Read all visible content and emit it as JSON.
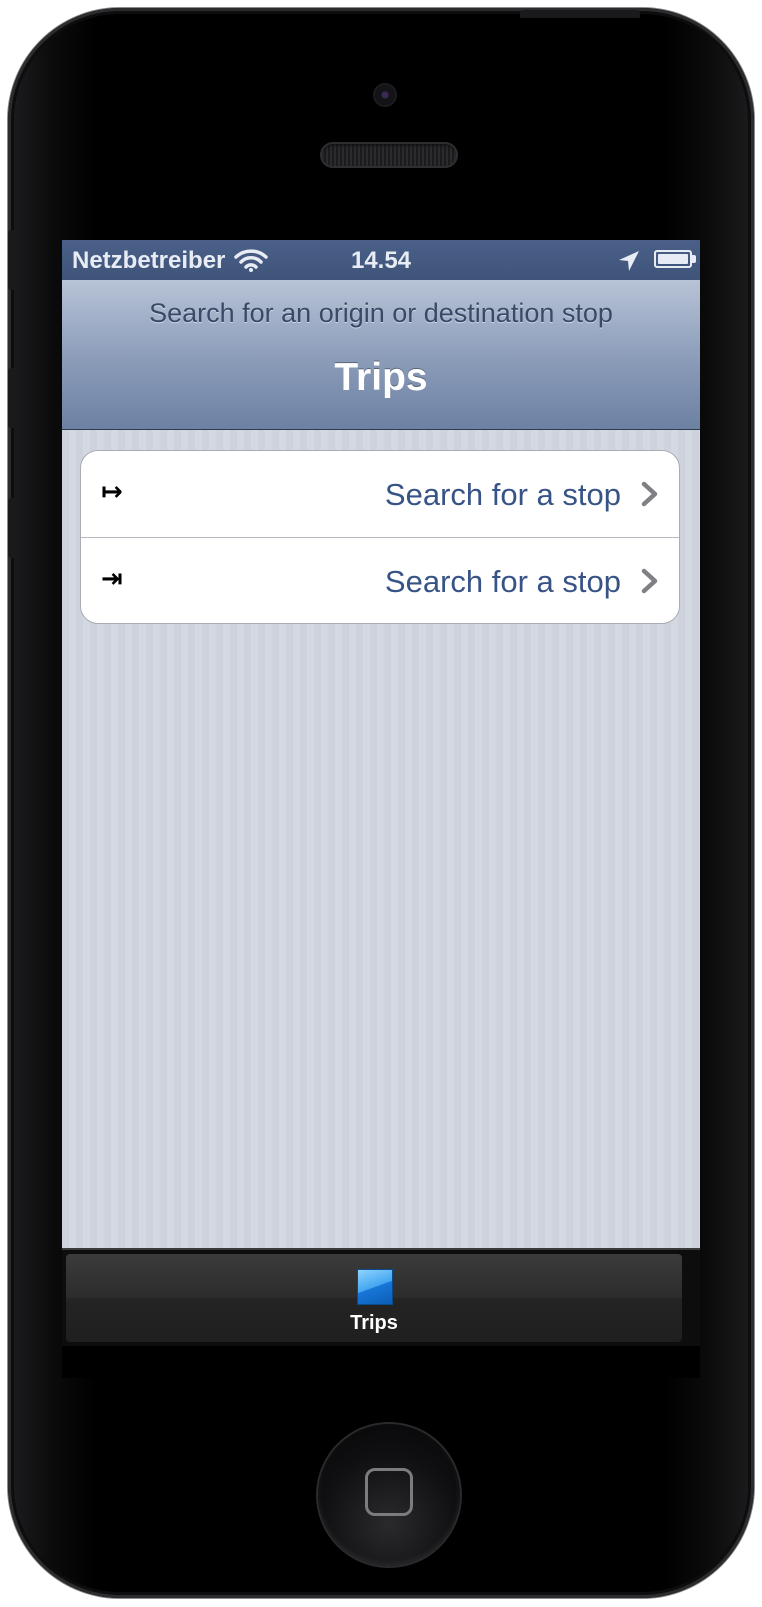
{
  "status_bar": {
    "carrier": "Netzbetreiber",
    "time": "14.54",
    "wifi_icon": "wifi-icon",
    "location_icon": "location-arrow-icon",
    "battery_icon": "battery-full-icon"
  },
  "nav_bar": {
    "prompt": "Search for an origin or destination stop",
    "title": "Trips"
  },
  "stops": [
    {
      "icon_glyph": "↦",
      "icon_name": "origin-arrow-icon",
      "label": "Search for a stop"
    },
    {
      "icon_glyph": "⇥",
      "icon_name": "destination-arrow-icon",
      "label": "Search for a stop"
    }
  ],
  "tab_bar": {
    "items": [
      {
        "label": "Trips",
        "icon": "trips-tab-icon",
        "selected": true
      }
    ]
  },
  "colors": {
    "nav_accent": "#6d81a3",
    "cell_label": "#385487",
    "tab_selected": "#42a5f0"
  }
}
